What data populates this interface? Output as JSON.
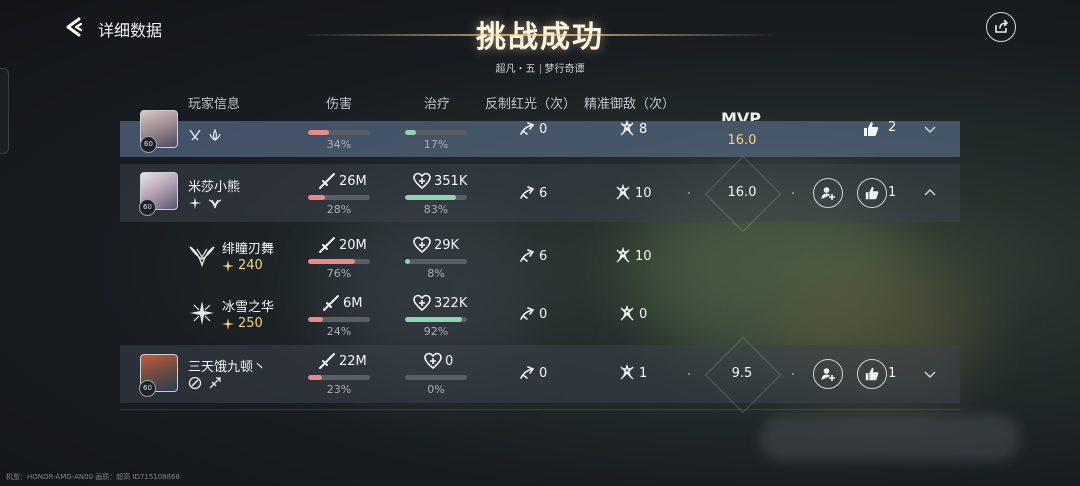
{
  "header": {
    "page_label": "详细数据",
    "title": "挑战成功",
    "subtitle_left": "超凡・五",
    "subtitle_right": "梦行奇谭"
  },
  "columns": [
    "玩家信息",
    "伤害",
    "治疗",
    "反制红光（次）",
    "精准御敌（次）"
  ],
  "players": [
    {
      "name": "",
      "level": "60",
      "damage": "",
      "damage_pct": "34%",
      "damage_frac": 0.34,
      "heal": "",
      "heal_pct": "17%",
      "heal_frac": 0.17,
      "counter": "0",
      "parry": "8",
      "badge": "MVP",
      "score": "16.0",
      "likes": "2"
    },
    {
      "name": "米莎小熊",
      "level": "60",
      "damage": "26M",
      "damage_pct": "28%",
      "damage_frac": 0.28,
      "heal": "351K",
      "heal_pct": "83%",
      "heal_frac": 0.83,
      "counter": "6",
      "parry": "10",
      "score": "16.0",
      "likes": "1"
    },
    {
      "name": "三天饿九顿丶",
      "level": "60",
      "damage": "22M",
      "damage_pct": "23%",
      "damage_frac": 0.23,
      "heal": "0",
      "heal_pct": "0%",
      "heal_frac": 0.0,
      "counter": "0",
      "parry": "1",
      "score": "9.5",
      "likes": "1"
    }
  ],
  "sub_rows": [
    {
      "name": "绯瞳刃舞",
      "power": "240",
      "damage": "20M",
      "damage_pct": "76%",
      "damage_frac": 0.76,
      "heal": "29K",
      "heal_pct": "8%",
      "heal_frac": 0.08,
      "counter": "6",
      "parry": "10"
    },
    {
      "name": "冰雪之华",
      "power": "250",
      "damage": "6M",
      "damage_pct": "24%",
      "damage_frac": 0.24,
      "heal": "322K",
      "heal_pct": "92%",
      "heal_frac": 0.92,
      "counter": "0",
      "parry": "0"
    }
  ],
  "footer": "机型：HONOR-AMG-AN00 画质：超高 ID715108868",
  "colors": {
    "damage_fill": "#e88a8a",
    "heal_fill": "#8ed6b2",
    "gold": "#f3d27a",
    "mvp_row": "#556882"
  }
}
